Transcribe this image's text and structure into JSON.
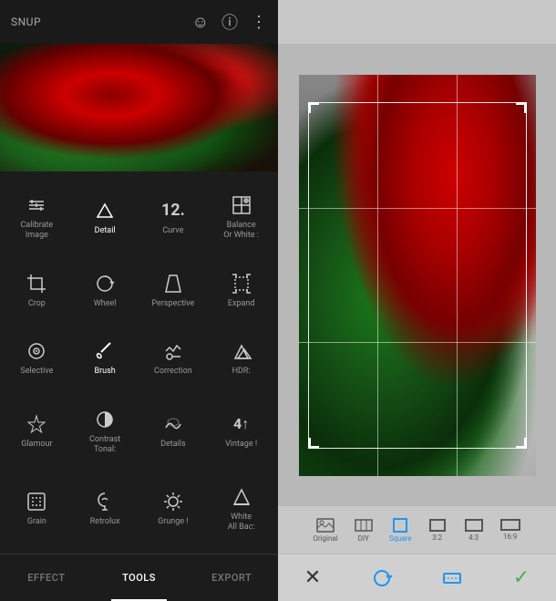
{
  "app": {
    "title": "SNUP",
    "left_panel": {
      "top_bar": {
        "title": "SNUP",
        "icons": [
          "face-icon",
          "info-icon",
          "more-icon"
        ]
      },
      "tools": [
        {
          "id": "calibrate",
          "icon": "⊞",
          "label": "Calibrate\nImage"
        },
        {
          "id": "detail",
          "icon": "▽",
          "label": "Detail",
          "bold": true
        },
        {
          "id": "curve",
          "icon": "12.",
          "label": "Curve"
        },
        {
          "id": "balance",
          "icon": "⊡",
          "label": "Balance\nOr White",
          "highlight": true
        },
        {
          "id": "crop",
          "icon": "⌗",
          "label": "Crop"
        },
        {
          "id": "wheel",
          "icon": "↻",
          "label": "Wheel"
        },
        {
          "id": "perspective",
          "icon": "⬡",
          "label": "Perspective"
        },
        {
          "id": "expand",
          "icon": "⇱",
          "label": "Expand"
        },
        {
          "id": "selective",
          "icon": "◎",
          "label": "Selective"
        },
        {
          "id": "brush",
          "icon": "✏",
          "label": "Brush",
          "bold": true
        },
        {
          "id": "correction",
          "icon": "✱",
          "label": "Correction"
        },
        {
          "id": "hdr",
          "icon": "▲▲",
          "label": "HDR:"
        },
        {
          "id": "glamour",
          "icon": "✦",
          "label": "Glamour"
        },
        {
          "id": "contrast",
          "icon": "◑",
          "label": "Contrast\nTonal:"
        },
        {
          "id": "details2",
          "icon": "☁",
          "label": "Details"
        },
        {
          "id": "vintage",
          "icon": "4↑",
          "label": "Vintage !"
        },
        {
          "id": "grain",
          "icon": "⊡",
          "label": "Grain"
        },
        {
          "id": "retrolux",
          "icon": "👁",
          "label": "Retrolux"
        },
        {
          "id": "grunge",
          "icon": "❋",
          "label": "Grunge !"
        },
        {
          "id": "white",
          "icon": "▲",
          "label": "White\nAll Bac:"
        }
      ],
      "tabs": [
        {
          "id": "effect",
          "label": "EFFECT",
          "active": false
        },
        {
          "id": "tools",
          "label": "TOOLS",
          "active": true
        },
        {
          "id": "export",
          "label": "EXPORT",
          "active": false
        }
      ]
    },
    "right_panel": {
      "aspect_ratios": [
        {
          "id": "original",
          "label": "Original",
          "shape": "photo"
        },
        {
          "id": "diy",
          "label": "DIY",
          "shape": "wide"
        },
        {
          "id": "square",
          "label": "Square",
          "shape": "square",
          "active": true
        },
        {
          "id": "32",
          "label": "3:2",
          "shape": "43"
        },
        {
          "id": "43",
          "label": "4:3",
          "shape": "wide2"
        },
        {
          "id": "169",
          "label": "16:9",
          "shape": "169"
        }
      ],
      "actions": [
        {
          "id": "cancel",
          "icon": "✕",
          "color": "dark"
        },
        {
          "id": "rotate",
          "icon": "↻",
          "color": "blue"
        },
        {
          "id": "expand-icon",
          "icon": "⇔",
          "color": "blue"
        },
        {
          "id": "confirm",
          "icon": "✓",
          "color": "green"
        }
      ]
    }
  }
}
